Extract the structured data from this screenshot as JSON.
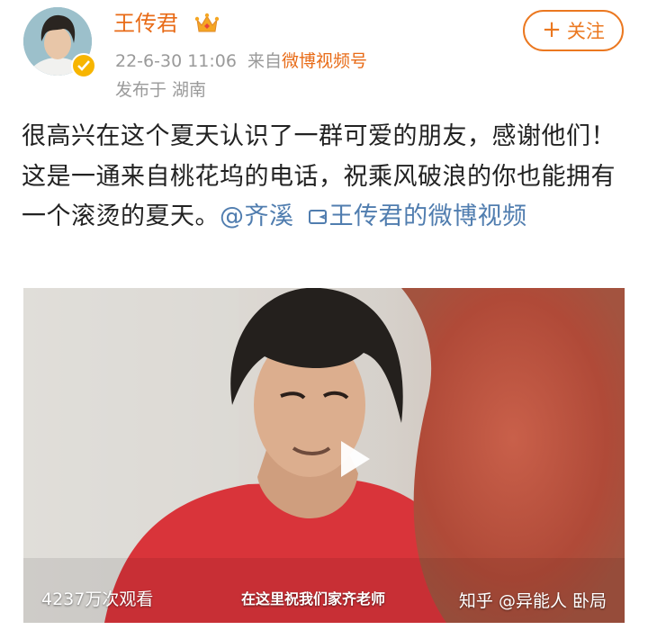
{
  "user": {
    "name": "王传君",
    "date": "22-6-30 11:06",
    "source_prefix": "来自",
    "source_name": "微博视频号",
    "location": "发布于 湖南"
  },
  "follow_button": {
    "plus": "+",
    "label": "关注"
  },
  "post": {
    "text": "很高兴在这个夏天认识了一群可爱的朋友，感谢他们！这是一通来自桃花坞的电话，祝乘风破浪的你也能拥有一个滚烫的夏天。",
    "mention": "@齐溪",
    "video_link": "王传君的微博视频"
  },
  "video": {
    "view_count": "4237万次观看",
    "subtitle": "在这里祝我们家齐老师",
    "watermark": "知乎 @异能人 卧局"
  },
  "icons": {
    "verified": "verified-badge-icon",
    "crown": "crown-icon",
    "video_link": "video-camera-icon",
    "play": "play-icon"
  },
  "colors": {
    "accent": "#e86b17",
    "link": "#507daf",
    "verified": "#f7b500"
  }
}
